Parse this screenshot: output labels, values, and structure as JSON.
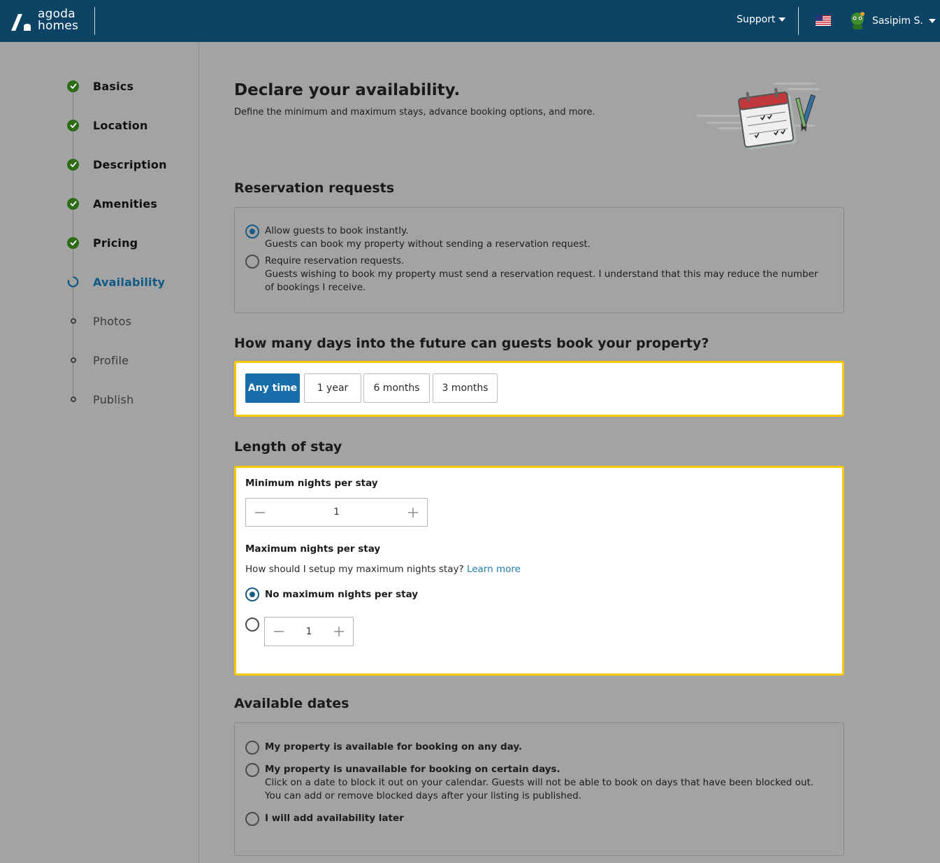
{
  "header": {
    "logo_line1": "agoda",
    "logo_line2": "homes",
    "support_label": "Support",
    "user_name": "Sasipim S."
  },
  "sidebar": {
    "steps": [
      {
        "label": "Basics",
        "state": "done"
      },
      {
        "label": "Location",
        "state": "done"
      },
      {
        "label": "Description",
        "state": "done"
      },
      {
        "label": "Amenities",
        "state": "done"
      },
      {
        "label": "Pricing",
        "state": "done"
      },
      {
        "label": "Availability",
        "state": "current"
      },
      {
        "label": "Photos",
        "state": "pending"
      },
      {
        "label": "Profile",
        "state": "pending"
      },
      {
        "label": "Publish",
        "state": "pending"
      }
    ]
  },
  "main": {
    "title": "Declare your availability.",
    "subtitle": "Define the minimum and maximum stays, advance booking options, and more.",
    "reservation": {
      "title": "Reservation requests",
      "options": [
        {
          "title": "Allow guests to book instantly.",
          "desc": "Guests can book my property without sending a reservation request.",
          "selected": true
        },
        {
          "title": "Require reservation requests.",
          "desc": "Guests wishing to book my property must send a reservation request. I understand that this may reduce the number of bookings I receive.",
          "selected": false
        }
      ]
    },
    "future": {
      "title": "How many days into the future can guests book your property?",
      "options": [
        "Any time",
        "1 year",
        "6 months",
        "3 months"
      ],
      "selected": "Any time"
    },
    "length": {
      "title": "Length of stay",
      "min_label": "Minimum nights per stay",
      "min_value": "1",
      "max_label": "Maximum nights per stay",
      "max_help": "How should I setup my maximum nights stay?",
      "learn_more": "Learn more",
      "no_max_label": "No maximum nights per stay",
      "max_value": "1"
    },
    "dates": {
      "title": "Available dates",
      "options": [
        {
          "title": "My property is available for booking on any day.",
          "desc": ""
        },
        {
          "title": "My property is unavailable for booking on certain days.",
          "desc": "Click on a date to block it out on your calendar. Guests will not be able to book on days that have been blocked out. You can add or remove blocked days after your listing is published."
        },
        {
          "title": "I will add availability later",
          "desc": ""
        }
      ]
    }
  },
  "colors": {
    "header_bg": "#0d4466",
    "accent": "#176ea8",
    "highlight": "#f5c800",
    "done_check": "#2c6b17"
  }
}
